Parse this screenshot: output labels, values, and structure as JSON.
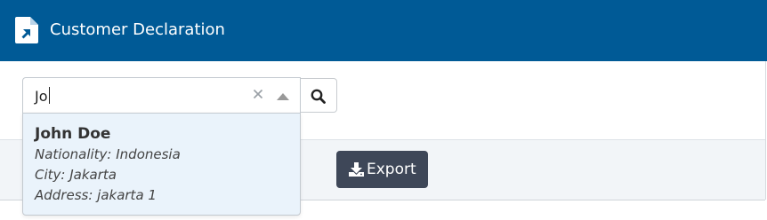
{
  "colors": {
    "header_bg": "#005a96",
    "export_bg": "#3e4758",
    "option_highlight": "#eaf3fb"
  },
  "header": {
    "title": "Customer Declaration",
    "icon": "file-export-icon"
  },
  "search": {
    "value": "Jo",
    "clear_symbol": "×",
    "button_icon": "search-icon"
  },
  "dropdown": {
    "options": [
      {
        "name": "John Doe",
        "nationality": "Nationality: Indonesia",
        "city": "City: Jakarta",
        "address": "Address: jakarta 1"
      }
    ]
  },
  "toolbar": {
    "export_label": "Export",
    "export_icon": "download-icon"
  }
}
